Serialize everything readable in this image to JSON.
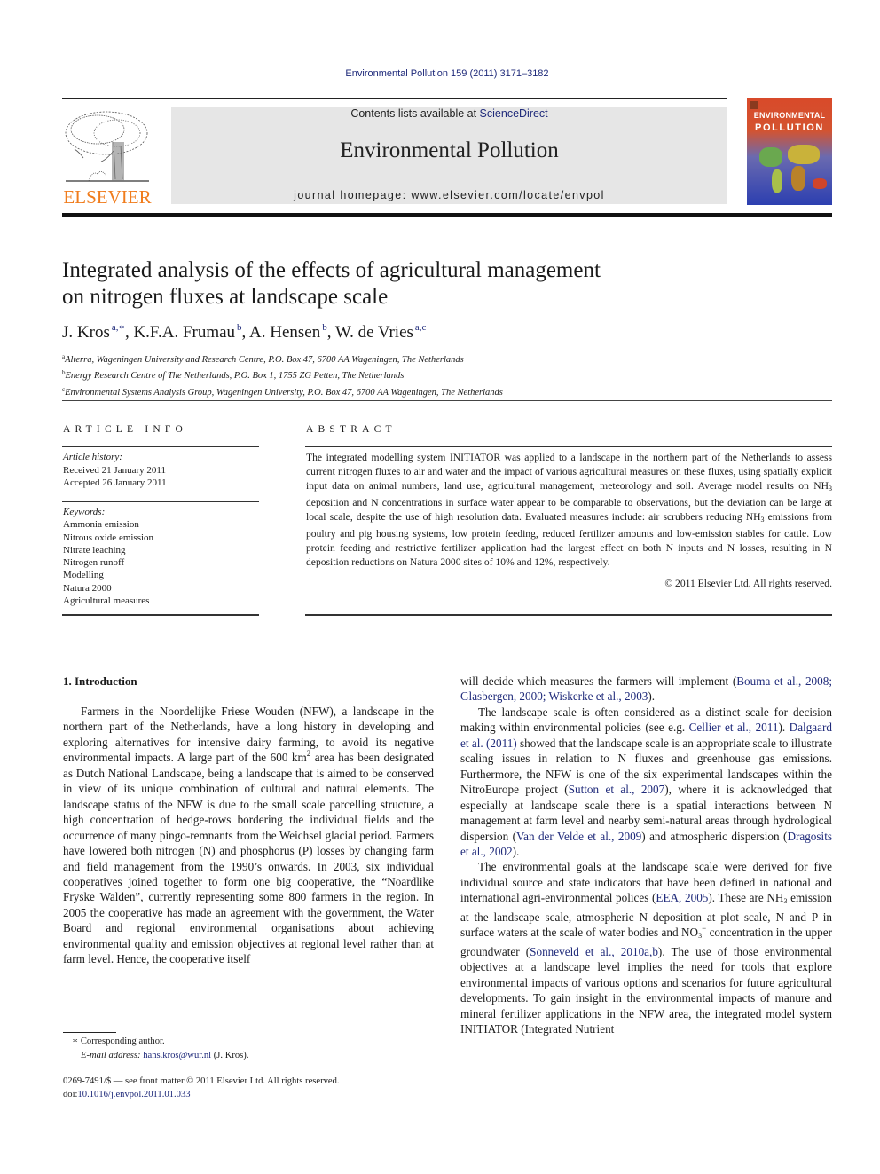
{
  "header": {
    "journal_reference": "Environmental Pollution 159 (2011) 3171–3182",
    "contents_prefix": "Contents lists available at ",
    "contents_link": "ScienceDirect",
    "journal_title": "Environmental Pollution",
    "homepage": "journal homepage: www.elsevier.com/locate/envpol",
    "publisher_logo_text": "ELSEVIER",
    "cover": {
      "line1": "ENVIRONMENTAL",
      "line2": "POLLUTION"
    },
    "colors": {
      "link": "#1f2a7a",
      "elsevier_orange": "#f07c1c",
      "banner_gray": "#e6e6e6"
    }
  },
  "article": {
    "title_line1": "Integrated analysis of the effects of agricultural management",
    "title_line2": "on nitrogen fluxes at landscape scale",
    "authors": [
      {
        "name": "J. Kros",
        "sup": "a,∗",
        "sep": ", "
      },
      {
        "name": "K.F.A. Frumau",
        "sup": "b",
        "sep": ", "
      },
      {
        "name": "A. Hensen",
        "sup": "b",
        "sep": ", "
      },
      {
        "name": "W. de Vries",
        "sup": "a,c",
        "sep": ""
      }
    ],
    "affiliations": [
      {
        "key": "a",
        "text": "Alterra, Wageningen University and Research Centre, P.O. Box 47, 6700 AA Wageningen, The Netherlands"
      },
      {
        "key": "b",
        "text": "Energy Research Centre of The Netherlands, P.O. Box 1, 1755 ZG Petten, The Netherlands"
      },
      {
        "key": "c",
        "text": "Environmental Systems Analysis Group, Wageningen University, P.O. Box 47, 6700 AA Wageningen, The Netherlands"
      }
    ]
  },
  "article_info": {
    "heading": "ARTICLE INFO",
    "history_label": "Article history:",
    "received": "Received 21 January 2011",
    "accepted": "Accepted 26 January 2011",
    "keywords_label": "Keywords:",
    "keywords": [
      "Ammonia emission",
      "Nitrous oxide emission",
      "Nitrate leaching",
      "Nitrogen runoff",
      "Modelling",
      "Natura 2000",
      "Agricultural measures"
    ]
  },
  "abstract": {
    "heading": "ABSTRACT",
    "part1": "The integrated modelling system INITIATOR was applied to a landscape in the northern part of the Netherlands to assess current nitrogen fluxes to air and water and the impact of various agricultural measures on these fluxes, using spatially explicit input data on animal numbers, land use, agricultural management, meteorology and soil. Average model results on NH",
    "part2": " deposition and N concentrations in surface water appear to be comparable to observations, but the deviation can be large at local scale, despite the use of high resolution data. Evaluated measures include: air scrubbers reducing NH",
    "part3": " emissions from poultry and pig housing systems, low protein feeding, reduced fertilizer amounts and low-emission stables for cattle. Low protein feeding and restrictive fertilizer application had the largest effect on both N inputs and N losses, resulting in N deposition reductions on Natura 2000 sites of 10% and 12%, respectively.",
    "subscript": "3",
    "copyright": "© 2011 Elsevier Ltd. All rights reserved."
  },
  "introduction": {
    "heading": "1.  Introduction",
    "left_p1_a": "Farmers in the Noordelijke Friese Wouden (NFW), a landscape in the northern part of the Netherlands, have a long history in developing and exploring alternatives for intensive dairy farming, to avoid its negative environmental impacts. A large part of the 600 km",
    "left_p1_sup": "2",
    "left_p1_b": " area has been designated as Dutch National Landscape, being a landscape that is aimed to be conserved in view of its unique combination of cultural and natural elements. The landscape status of the NFW is due to the small scale parcelling structure, a high concentration of hedge-rows bordering the individual fields and the occurrence of many pingo-remnants from the Weichsel glacial period. Farmers have lowered both nitrogen (N) and phosphorus (P) losses by changing farm and field management from the 1990’s onwards. In 2003, six individual cooperatives joined together to form one big cooperative, the “Noardlike Fryske Walden”, currently representing some 800 farmers in the region. In 2005 the cooperative has made an agreement with the government, the Water Board and regional environmental organisations about achieving environmental quality and emission objectives at regional level rather than at farm level. Hence, the cooperative itself",
    "right_p0_a": "will decide which measures the farmers will implement (",
    "right_p0_link": "Bouma et al., 2008; Glasbergen, 2000; Wiskerke et al., 2003",
    "right_p0_b": ").",
    "right_p1_a": "The landscape scale is often considered as a distinct scale for decision making within environmental policies (see e.g. ",
    "right_p1_link1": "Cellier et al., 2011",
    "right_p1_b": "). ",
    "right_p1_link2": "Dalgaard et al. (2011)",
    "right_p1_c": " showed that the landscape scale is an appropriate scale to illustrate scaling issues in relation to N fluxes and greenhouse gas emissions. Furthermore, the NFW is one of the six experimental landscapes within the NitroEurope project (",
    "right_p1_link3": "Sutton et al., 2007",
    "right_p1_d": "), where it is acknowledged that especially at landscape scale there is a spatial interactions between N management at farm level and nearby semi-natural areas through hydrological dispersion (",
    "right_p1_link4": "Van der Velde et al., 2009",
    "right_p1_e": ") and atmospheric dispersion (",
    "right_p1_link5": "Dragosits et al., 2002",
    "right_p1_f": ").",
    "right_p2_a": "The environmental goals at the landscape scale were derived for five individual source and state indicators that have been defined in national and international agri-environmental polices (",
    "right_p2_link1": "EEA, 2005",
    "right_p2_b": "). These are NH",
    "right_p2_sub1": "3",
    "right_p2_c": " emission at the landscape scale, atmospheric N deposition at plot scale, N and P in surface waters at the scale of water bodies and NO",
    "right_p2_sub2": "3",
    "right_p2_sup2": "−",
    "right_p2_d": " concentration in the upper groundwater (",
    "right_p2_link2": "Sonneveld et al., 2010a,b",
    "right_p2_e": "). The use of those environmental objectives at a landscape level implies the need for tools that explore environmental impacts of various options and scenarios for future agricultural developments. To gain insight in the environmental impacts of manure and mineral fertilizer applications in the NFW area, the integrated model system INITIATOR (Integrated Nutrient"
  },
  "footnotes": {
    "corresponding": "∗ Corresponding author.",
    "email_label": "E-mail address: ",
    "email": "hans.kros@wur.nl",
    "email_suffix": " (J. Kros).",
    "issn_line": "0269-7491/$ — see front matter © 2011 Elsevier Ltd. All rights reserved.",
    "doi_label": "doi:",
    "doi": "10.1016/j.envpol.2011.01.033"
  }
}
